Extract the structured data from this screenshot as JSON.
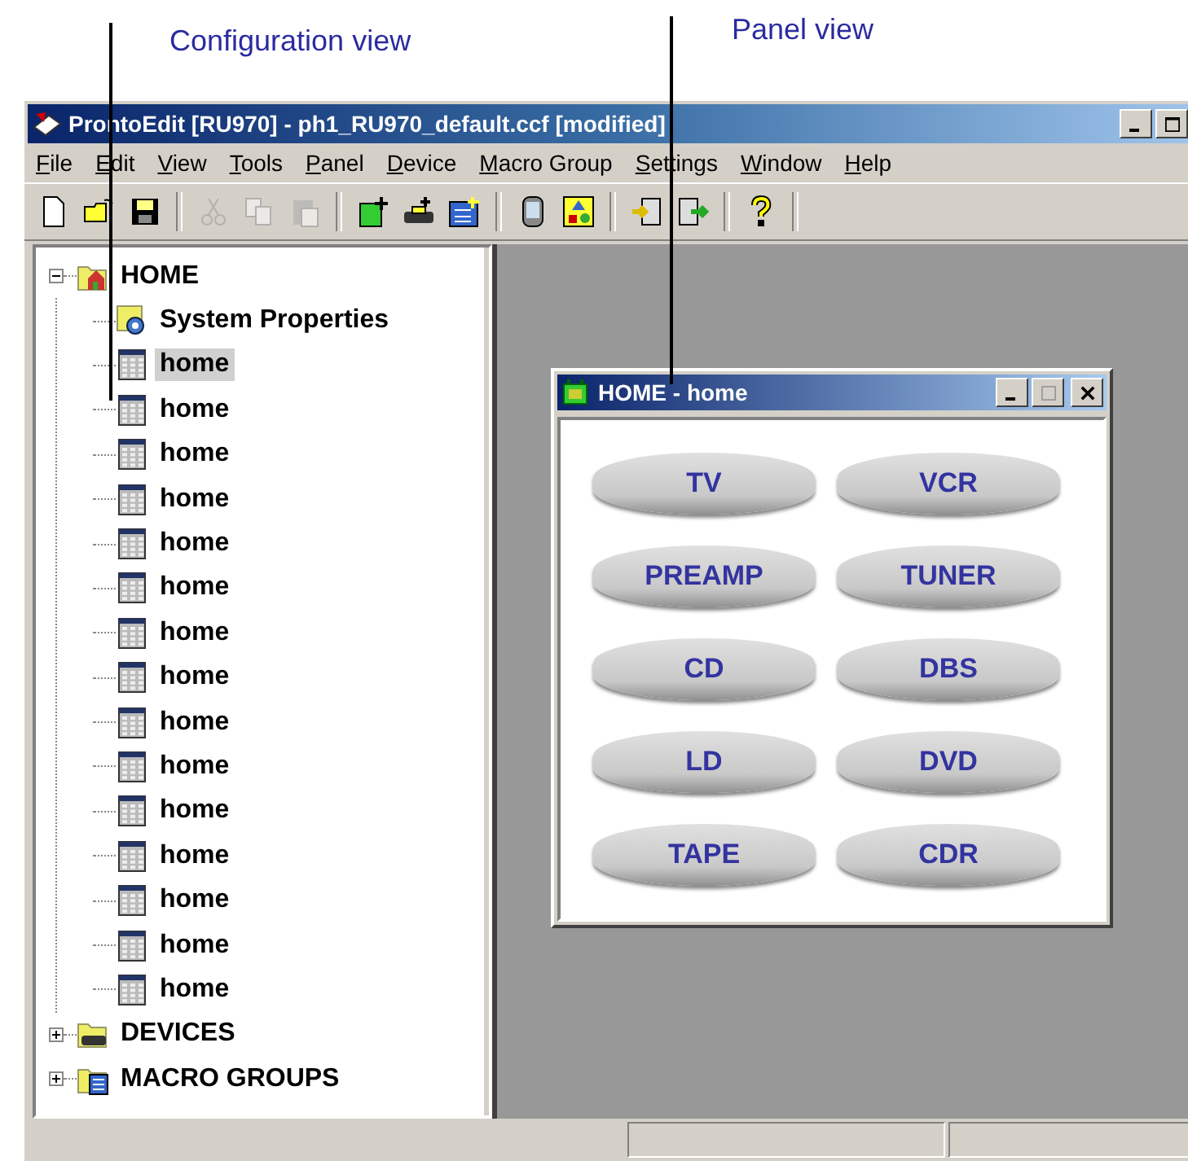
{
  "callouts": [
    {
      "label": "Configuration view",
      "kind": "tree"
    },
    {
      "label": "Panel view",
      "kind": "panel"
    }
  ],
  "window": {
    "title": "ProntoEdit [RU970] - ph1_RU970_default.ccf [modified]"
  },
  "menu": [
    "File",
    "Edit",
    "View",
    "Tools",
    "Panel",
    "Device",
    "Macro Group",
    "Settings",
    "Window",
    "Help"
  ],
  "toolbar": [
    [
      {
        "kind": "new",
        "disabled": false
      },
      {
        "kind": "open",
        "disabled": false
      },
      {
        "kind": "save",
        "disabled": false
      }
    ],
    [
      {
        "kind": "cut",
        "disabled": true
      },
      {
        "kind": "copy",
        "disabled": true
      },
      {
        "kind": "paste",
        "disabled": true
      }
    ],
    [
      {
        "kind": "add-panel",
        "disabled": false
      },
      {
        "kind": "add-device",
        "disabled": false
      },
      {
        "kind": "add-macro",
        "disabled": false
      }
    ],
    [
      {
        "kind": "remote",
        "disabled": false
      },
      {
        "kind": "shapes",
        "disabled": false
      }
    ],
    [
      {
        "kind": "import",
        "disabled": false
      },
      {
        "kind": "export",
        "disabled": false
      }
    ],
    [
      {
        "kind": "help",
        "disabled": false
      }
    ]
  ],
  "tree": [
    {
      "label": "HOME",
      "kind": "home",
      "expanded": true,
      "children": [
        {
          "label": "System Properties",
          "kind": "properties",
          "selected": false
        },
        {
          "label": "home",
          "kind": "panel",
          "selected": true
        },
        {
          "label": "home",
          "kind": "panel",
          "selected": false
        },
        {
          "label": "home",
          "kind": "panel",
          "selected": false
        },
        {
          "label": "home",
          "kind": "panel",
          "selected": false
        },
        {
          "label": "home",
          "kind": "panel",
          "selected": false
        },
        {
          "label": "home",
          "kind": "panel",
          "selected": false
        },
        {
          "label": "home",
          "kind": "panel",
          "selected": false
        },
        {
          "label": "home",
          "kind": "panel",
          "selected": false
        },
        {
          "label": "home",
          "kind": "panel",
          "selected": false
        },
        {
          "label": "home",
          "kind": "panel",
          "selected": false
        },
        {
          "label": "home",
          "kind": "panel",
          "selected": false
        },
        {
          "label": "home",
          "kind": "panel",
          "selected": false
        },
        {
          "label": "home",
          "kind": "panel",
          "selected": false
        },
        {
          "label": "home",
          "kind": "panel",
          "selected": false
        },
        {
          "label": "home",
          "kind": "panel",
          "selected": false
        }
      ]
    },
    {
      "label": "DEVICES",
      "kind": "devices",
      "expanded": false
    },
    {
      "label": "MACRO GROUPS",
      "kind": "macros",
      "expanded": false
    }
  ],
  "panel_window": {
    "title": "HOME - home",
    "buttons": [
      "TV",
      "VCR",
      "PREAMP",
      "TUNER",
      "CD",
      "DBS",
      "LD",
      "DVD",
      "TAPE",
      "CDR"
    ]
  }
}
